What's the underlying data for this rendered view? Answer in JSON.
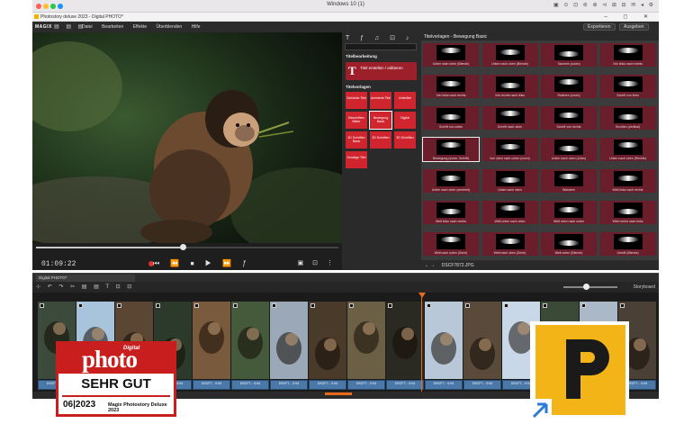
{
  "mac": {
    "title": "Windows 10 (1)",
    "dots": [
      "#ff5f57",
      "#febc2e",
      "#28c840",
      "#1e90ff"
    ]
  },
  "app": {
    "title": "Photostory deluxe 2023 - Digital PHOTO*",
    "window_controls": "–  ◻  ✕"
  },
  "menubar": {
    "logo": "MAGIX",
    "toolbar_icons": "▤ ▤ ▤",
    "menus": [
      "Datei",
      "Bearbeiten",
      "Effekte",
      "Überblenden",
      "Hilfe"
    ],
    "btn_export": "Exportieren",
    "btn_export2": "Ausgeben"
  },
  "preview": {
    "timecode": "01:09:22",
    "transport": "⏮ ⏪ ⏹ ▶ ⏩ ƒ",
    "right_icons": "▣ ⊡ ⋮"
  },
  "midpanel": {
    "icons": "T ƒ ♫ ⊡ ♪",
    "sec1": "Titelbearbeitung",
    "title_tile_label": "Titel erstellen / editieren",
    "sec2": "Titelvorlagen",
    "tiles": [
      "Schlichte Titel",
      "Animierte Titel",
      "Untertitel",
      "Beschriften Bilder",
      "Bewegung Basic",
      "Digital",
      "3D Schriften Basic",
      "3D Schriften",
      "3D Schriften",
      "Sonstige Titel"
    ]
  },
  "templates": {
    "header": "Titelvorlagen - Bewegung Basic",
    "footer_path": "DSCF7872.JPG",
    "items": [
      "Unten nach oben (Blende)",
      "Unten nach oben (Blende)",
      "Taumeln (zoom)",
      "Von links nach rechts",
      "Von links nach rechts",
      "Von rechts nach links",
      "Rotieren (zoom)",
      "Schrift von links",
      "Schrift von unten",
      "Schrift nach oben",
      "Schrift von rechts",
      "Scrollen (vertikal)",
      "Bewegung (zoom, Schrift)",
      "Von oben nach unten (zoom)",
      "Unten nach oben (Links)",
      "Unten nach oben (Rechts)",
      "Unten nach oben (zentriert)",
      "Unten nach oben",
      "Wandern",
      "Welt links nach rechts",
      "Welt links nach rechts",
      "Welt unten nach oben",
      "Welt oben nach unten",
      "Welt rechts nach links",
      "Welt nach unten (Serie)",
      "Welt nach oben (Serie)",
      "Welt unten (Blende)",
      "Schrift (Blende)"
    ]
  },
  "timeline": {
    "tab": "Digital PHOTO*",
    "toolbar_icons": "⊹ ↶ ↷ ✂ ▤ ▤ T ⊡ ⊡",
    "status": "Storyboard",
    "clip_labels": [
      "DSCF7... 0:04",
      "DSCF7... 0:04",
      "DSCF7... 0:04",
      "DSCF7... 0:04",
      "DSCF7... 0:04",
      "DSCF7... 0:04",
      "DSCF7... 0:04",
      "DSCF7... 0:04",
      "DSCF7... 0:04",
      "DSCF7... 0:04",
      "DSCF7... 0:04",
      "DSCF7... 0:04",
      "DSCF7... 0:04",
      "DSCF7... 0:04",
      "DSCF7... 0:04",
      "DSCF7... 0:04"
    ]
  },
  "badge": {
    "digital": "Digital",
    "photo": "photo",
    "verdict": "SEHR GUT",
    "issue": "06|2023",
    "product": "Magix Photostory Deluxe 2023"
  },
  "colors": {
    "accent_red": "#d0252e",
    "badge_red": "#c81e1e",
    "logo_yellow": "#f2b417",
    "playhead": "#e86b1c"
  }
}
